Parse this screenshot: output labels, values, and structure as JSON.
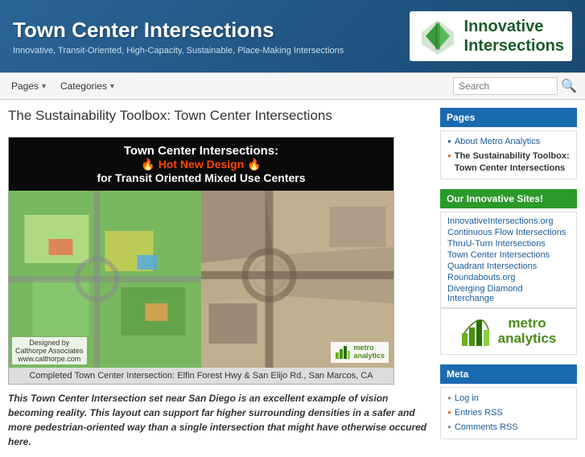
{
  "header": {
    "site_title": "Town Center Intersections",
    "site_tagline": "Innovative, Transit-Oriented, High-Capacity, Sustainable, Place-Making Intersections",
    "logo_text_line1": "Innovative",
    "logo_text_line2": "Intersections"
  },
  "navbar": {
    "pages_label": "Pages",
    "categories_label": "Categories",
    "search_placeholder": "Search"
  },
  "content": {
    "page_title": "The Sustainability Toolbox: Town Center Intersections",
    "article_title_line1": "Town Center Intersections:",
    "article_title_line2": "🔥 Hot New Design 🔥",
    "article_title_line3": "for Transit Oriented Mixed Use Centers",
    "left_caption_line1": "Designed by",
    "left_caption_line2": "Calthorpe Associates",
    "left_caption_line3": "www.calthorpe.com",
    "image_caption": "Completed Town Center Intersection:  Elfin Forest Hwy & San Elijo Rd., San Marcos, CA",
    "metro_logo_text": "metro\nanalytics",
    "description": "This Town Center Intersection set near San Diego is an excellent example of vision becoming reality. This layout can support far higher surrounding densities in a safer and more pedestrian-oriented way than a single intersection that might have otherwise occured here."
  },
  "sidebar": {
    "pages_title": "Pages",
    "pages_items": [
      {
        "label": "About Metro Analytics",
        "bullet": "blue"
      },
      {
        "label": "The Sustainability Toolbox: Town Center Intersections",
        "bullet": "orange",
        "active": true
      }
    ],
    "innovative_title": "Our Innovative Sites!",
    "innovative_items": [
      "InnovativeIntersections.org",
      "Continuous Flow Intersections",
      "ThruU-Turn Intersections",
      "Town Center Intersections",
      "Quadrant Intersections",
      "Roundabouts.org",
      "Diverging Diamond Interchange"
    ],
    "metro_analytics_text_line1": "metro",
    "metro_analytics_text_line2": "analytics",
    "meta_title": "Meta",
    "meta_items": [
      {
        "label": "Log in",
        "bullet": "gray"
      },
      {
        "label": "Entries RSS",
        "bullet": "orange"
      },
      {
        "label": "Comments RSS",
        "bullet": "gray"
      }
    ]
  }
}
